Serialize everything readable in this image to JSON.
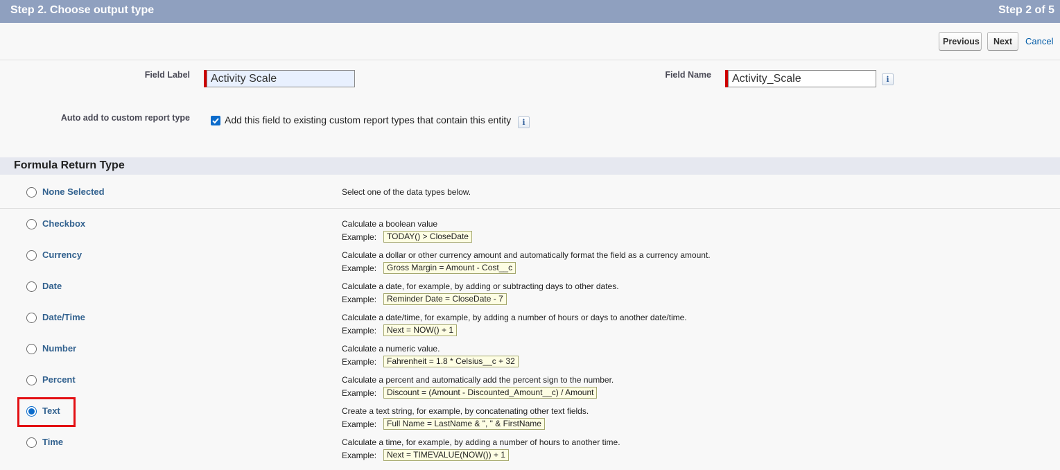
{
  "header": {
    "title": "Step 2. Choose output type",
    "step": "Step 2 of 5"
  },
  "buttons": {
    "previous": "Previous",
    "next": "Next",
    "cancel": "Cancel"
  },
  "fields": {
    "field_label_label": "Field Label",
    "field_label_value": "Activity Scale",
    "field_name_label": "Field Name",
    "field_name_value": "Activity_Scale",
    "info_glyph": "i",
    "auto_add_label": "Auto add to custom report type",
    "auto_add_checked": true,
    "auto_add_text": "Add this field to existing custom report types that contain this entity"
  },
  "section": {
    "title": "Formula Return Type"
  },
  "example_prefix": "Example:",
  "none_option": {
    "label": "None Selected",
    "description": "Select one of the data types below.",
    "checked": false
  },
  "types": [
    {
      "label": "Checkbox",
      "description": "Calculate a boolean value",
      "example": "TODAY() > CloseDate",
      "checked": false
    },
    {
      "label": "Currency",
      "description": "Calculate a dollar or other currency amount and automatically format the field as a currency amount.",
      "example": "Gross Margin = Amount - Cost__c",
      "checked": false
    },
    {
      "label": "Date",
      "description": "Calculate a date, for example, by adding or subtracting days to other dates.",
      "example": "Reminder Date = CloseDate - 7",
      "checked": false
    },
    {
      "label": "Date/Time",
      "description": "Calculate a date/time, for example, by adding a number of hours or days to another date/time.",
      "example": "Next = NOW() + 1",
      "checked": false
    },
    {
      "label": "Number",
      "description": "Calculate a numeric value.",
      "example": "Fahrenheit = 1.8 * Celsius__c + 32",
      "checked": false
    },
    {
      "label": "Percent",
      "description": "Calculate a percent and automatically add the percent sign to the number.",
      "example": "Discount = (Amount - Discounted_Amount__c) / Amount",
      "checked": false
    },
    {
      "label": "Text",
      "description": "Create a text string, for example, by concatenating other text fields.",
      "example": "Full Name = LastName & \", \" & FirstName",
      "checked": true
    },
    {
      "label": "Time",
      "description": "Calculate a time, for example, by adding a number of hours to another time.",
      "example": "Next = TIMEVALUE(NOW()) + 1",
      "checked": false
    }
  ],
  "colors": {
    "header_bg": "#8fa0bf",
    "accent": "#0b6bcb",
    "highlight": "#e30f13",
    "required": "#cc0000"
  }
}
